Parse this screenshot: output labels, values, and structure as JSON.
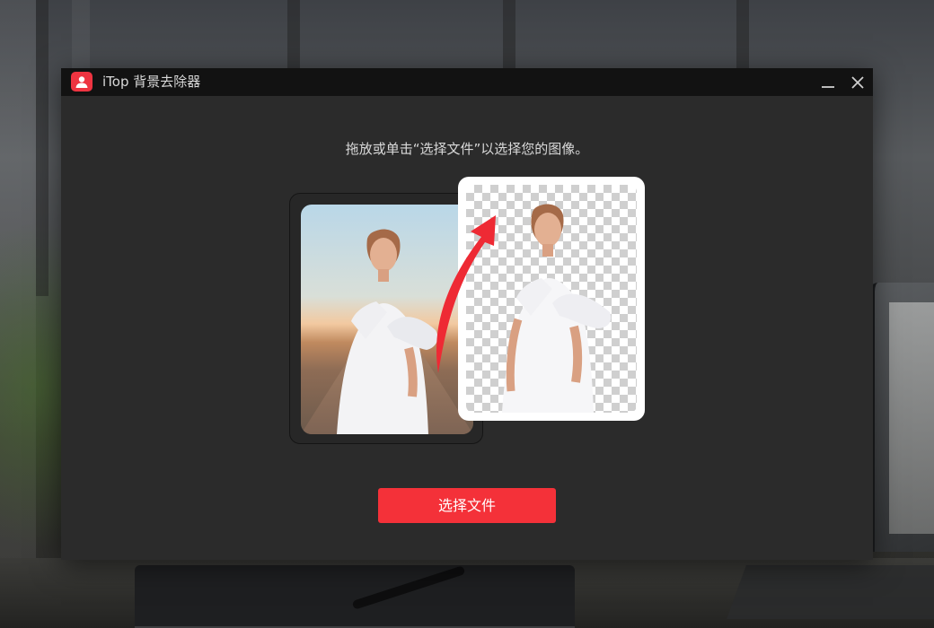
{
  "window": {
    "title": "iTop 背景去除器"
  },
  "main": {
    "instruction": "拖放或单击“选择文件”以选择您的图像。",
    "select_button_label": "选择文件"
  },
  "icons": {
    "logo": "user-icon",
    "minimize": "minimize-icon",
    "close": "close-icon",
    "arrow": "curved-arrow-icon"
  },
  "colors": {
    "accent": "#f43139",
    "window_bg": "#2b2b2b",
    "titlebar_bg": "#121212"
  }
}
